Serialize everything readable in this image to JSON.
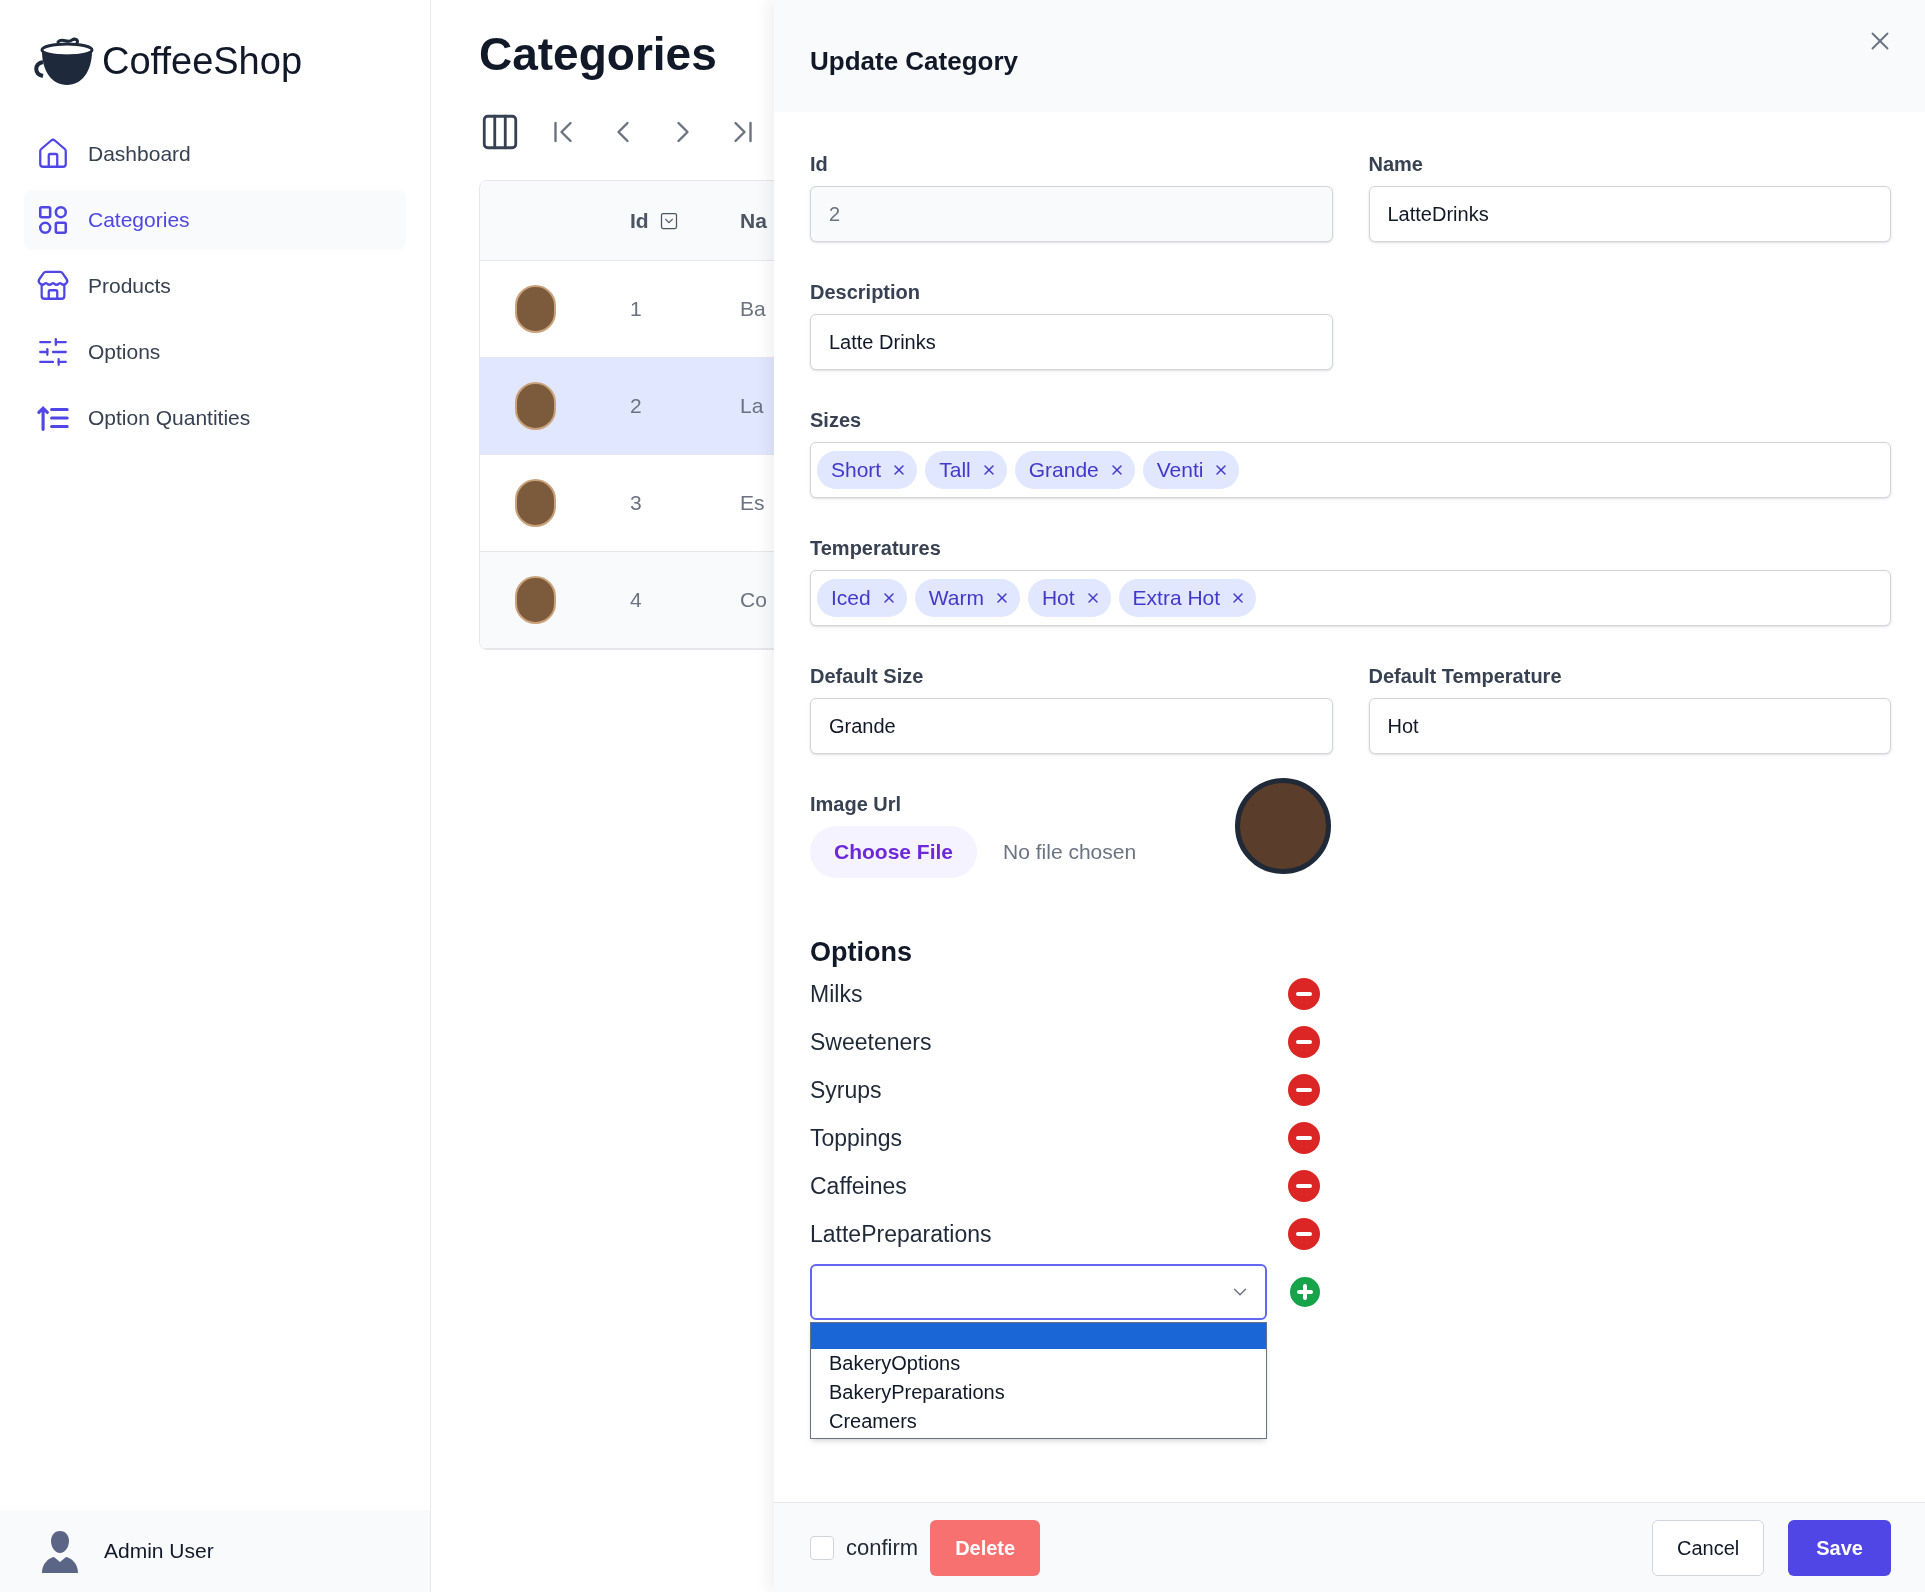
{
  "brand": "CoffeeShop",
  "nav": [
    {
      "label": "Dashboard",
      "selected": false
    },
    {
      "label": "Categories",
      "selected": true
    },
    {
      "label": "Products",
      "selected": false
    },
    {
      "label": "Options",
      "selected": false
    },
    {
      "label": "Option Quantities",
      "selected": false
    }
  ],
  "user": {
    "name": "Admin User"
  },
  "page": {
    "title": "Categories"
  },
  "table": {
    "columns": [
      "Id",
      "Na"
    ],
    "rows": [
      {
        "id": "1",
        "name": "Ba",
        "selected": false
      },
      {
        "id": "2",
        "name": "La",
        "selected": true
      },
      {
        "id": "3",
        "name": "Es",
        "selected": false
      },
      {
        "id": "4",
        "name": "Co",
        "selected": false
      }
    ]
  },
  "drawer": {
    "title": "Update Category",
    "id": {
      "label": "Id",
      "value": "2",
      "disabled": true
    },
    "name": {
      "label": "Name",
      "value": "LatteDrinks"
    },
    "description": {
      "label": "Description",
      "value": "Latte Drinks"
    },
    "sizes": {
      "label": "Sizes",
      "chips": [
        "Short",
        "Tall",
        "Grande",
        "Venti"
      ]
    },
    "temperatures": {
      "label": "Temperatures",
      "chips": [
        "Iced",
        "Warm",
        "Hot",
        "Extra Hot"
      ]
    },
    "default_size": {
      "label": "Default Size",
      "value": "Grande"
    },
    "default_temperature": {
      "label": "Default Temperature",
      "value": "Hot"
    },
    "image": {
      "label": "Image Url",
      "button": "Choose File",
      "status": "No file chosen"
    },
    "options": {
      "heading": "Options",
      "items": [
        "Milks",
        "Sweeteners",
        "Syrups",
        "Toppings",
        "Caffeines",
        "LattePreparations"
      ],
      "dropdown": {
        "expanded": true,
        "items": [
          {
            "label": "BakeryOptions",
            "selected": false
          },
          {
            "label": "BakeryPreparations",
            "selected": false
          },
          {
            "label": "Creamers",
            "selected": false
          }
        ]
      }
    },
    "footer": {
      "confirm": {
        "label": "confirm",
        "checked": false
      },
      "delete": "Delete",
      "cancel": "Cancel",
      "save": "Save"
    }
  }
}
